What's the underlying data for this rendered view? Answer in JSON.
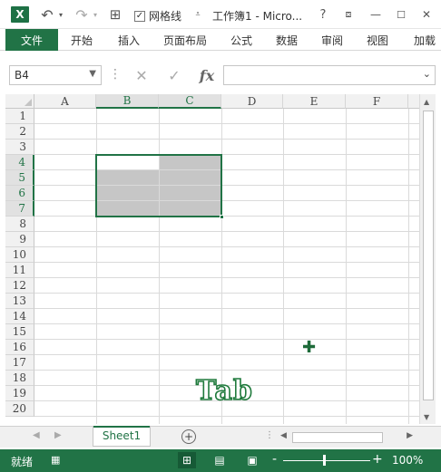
{
  "titlebar": {
    "logo": "X",
    "undo_icon": "undo-icon",
    "redo_icon": "redo-icon",
    "gridlines_label": "网格线",
    "gridlines_checked": true,
    "title": "工作簿1 - Micro...",
    "help": "?",
    "minimize": "—",
    "close": "✕"
  },
  "ribbon": {
    "tabs": [
      "文件",
      "开始",
      "插入",
      "页面布局",
      "公式",
      "数据",
      "审阅",
      "视图",
      "加载"
    ]
  },
  "formula_bar": {
    "name_box": "B4",
    "formula_value": ""
  },
  "grid": {
    "columns": [
      "A",
      "B",
      "C",
      "D",
      "E",
      "F"
    ],
    "rows": [
      "1",
      "2",
      "3",
      "4",
      "5",
      "6",
      "7",
      "8",
      "9",
      "10",
      "11",
      "12",
      "13",
      "14",
      "15",
      "16",
      "17",
      "18",
      "19",
      "20"
    ],
    "selected_columns": [
      "B",
      "C"
    ],
    "selected_rows": [
      "4",
      "5",
      "6",
      "7"
    ],
    "selection_range": "B4:C7",
    "active_cell": "B4",
    "overlay_text": "Tab"
  },
  "sheets": {
    "tabs": [
      "Sheet1"
    ],
    "active": "Sheet1",
    "add_label": "+"
  },
  "status": {
    "mode": "就绪",
    "zoom": "100%",
    "zoom_minus": "-",
    "zoom_plus": "+"
  },
  "colors": {
    "accent": "#217346",
    "selection_fill": "#c6c6c6"
  }
}
